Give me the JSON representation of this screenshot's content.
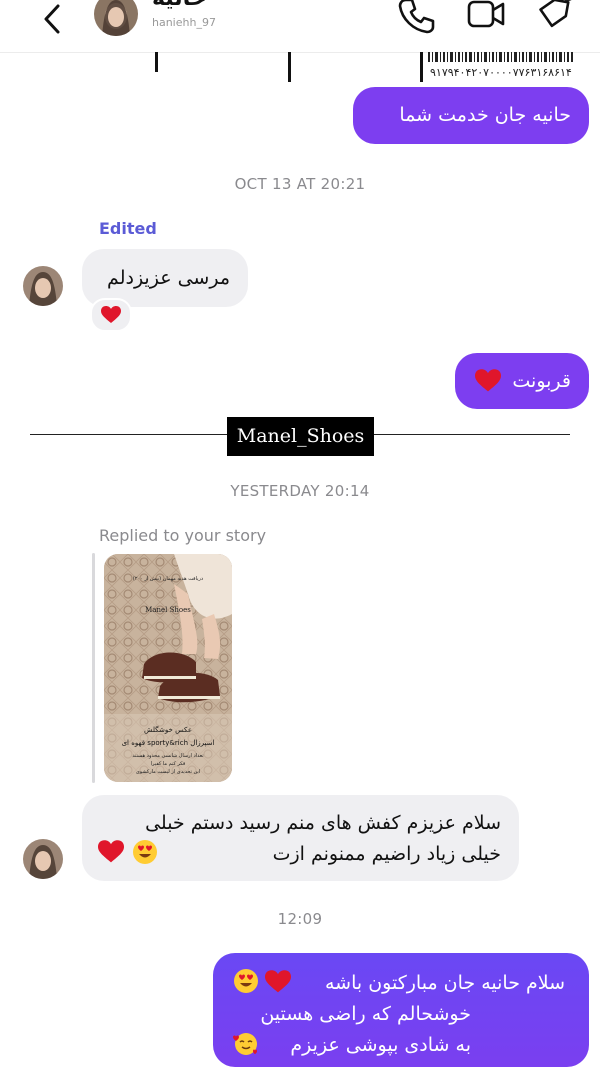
{
  "header": {
    "contact_name": "حانیه",
    "contact_sub": "haniehh_97"
  },
  "top_card": {
    "barcode_number": "۹۱۷۹۴۰۴۲۰۷۰۰۰۰۷۷۶۳۱۶۸۶۱۴"
  },
  "messages": {
    "m1_text": "حانیه جان خدمت شما",
    "ts1": "OCT 13 AT 20:21",
    "edited_label": "Edited",
    "m2_text": "مرسی عزیزدلم",
    "m3_text": "قربونت",
    "brand_banner": "Manel_Shoes",
    "ts2": "YESTERDAY 20:14",
    "replied_label": "Replied to your story",
    "story_brand": "Manel Shoes",
    "story_top_text": "دریافت هدیه مهمان (بیش از ۲۰۰)",
    "story_caption1": "عکس خوشگلش",
    "story_caption2": "اسپرزال sporty&rich قهوه ای",
    "story_caption3": "تعداد ارسال شانسی محدود هستند",
    "story_caption4": "فکر کنم ما کفیرا",
    "story_caption5": "این تحدیدی از لیست مارکشوی",
    "m4_line1": "سلام عزیزم کفش های منم رسید دستم خبلی",
    "m4_line2": "خیلی زیاد راضیم ممنونم ازت",
    "ts3": "12:09",
    "m5_line1": "سلام حانیه جان مبارکتون باشه",
    "m5_line2": "خوشحالم که راضی هستین",
    "m5_line3": "به شادی بپوشی عزیزم"
  },
  "colors": {
    "outgoing_bubble": "#7d3ef0",
    "incoming_bubble": "#efeff2",
    "edited_label": "#5b5bd6",
    "banner_bg": "#000000"
  },
  "icons": [
    "back-chevron-icon",
    "phone-icon",
    "video-call-icon",
    "tag-icon",
    "heart-reaction-icon"
  ]
}
